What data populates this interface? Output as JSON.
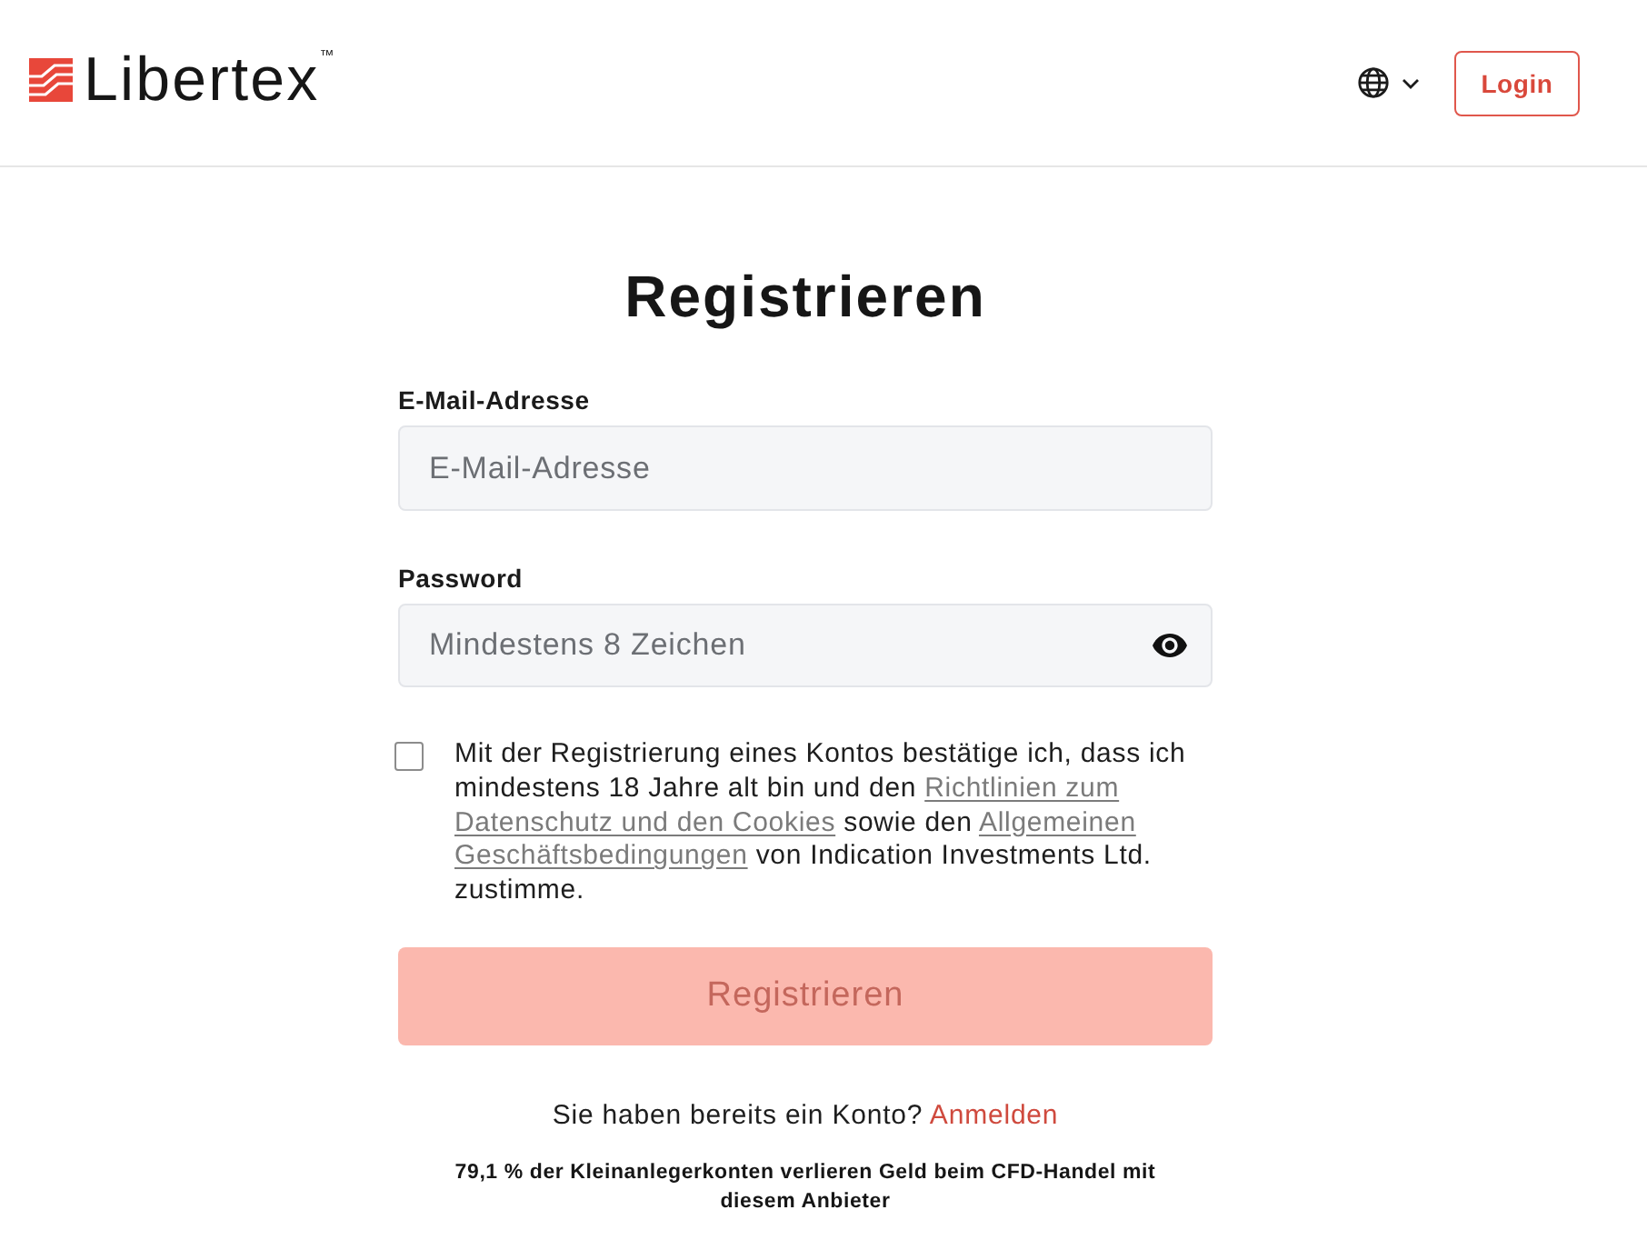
{
  "header": {
    "logo": {
      "name": "Libertex",
      "mark": "™"
    },
    "login_button": {
      "label": "Login"
    }
  },
  "title": "Registrieren",
  "fields": [
    {
      "kind": "email",
      "label": "E-Mail-Adresse",
      "placeholder": "E-Mail-Adresse"
    },
    {
      "kind": "password",
      "label": "Password",
      "placeholder": "Mindestens 8 Zeichen"
    }
  ],
  "consent": {
    "checked": false,
    "parts": [
      {
        "kind": "text",
        "text": "Mit der Registrierung eines Kontos bestätige ich, dass ich mindestens 18 Jahre alt bin und den "
      },
      {
        "kind": "link",
        "text": "Richtlinien zum"
      },
      {
        "kind": "link",
        "text": "Datenschutz und den Cookies"
      },
      {
        "kind": "text",
        "text": " sowie den "
      },
      {
        "kind": "link",
        "text": "Allgemeinen"
      },
      {
        "kind": "link",
        "text": "Geschäftsbedingungen"
      },
      {
        "kind": "text",
        "text": " von Indication Investments Ltd. zustimme."
      }
    ]
  },
  "submit_button": {
    "label": "Registrieren",
    "disabled": true
  },
  "login_prompt": {
    "text": "Sie haben bereits ein Konto?",
    "link": "Anmelden"
  },
  "risk_warning": "79,1 % der Kleinanlegerkonten verlieren Geld beim CFD-Handel mit diesem Anbieter"
}
